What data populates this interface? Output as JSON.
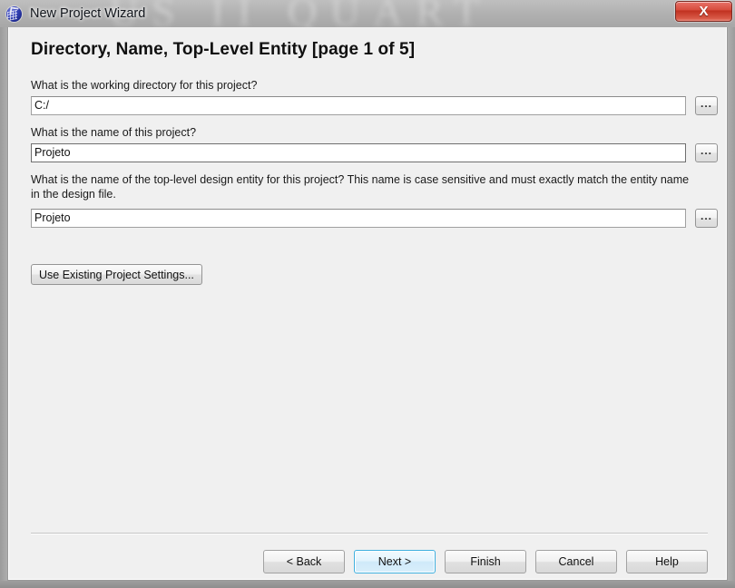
{
  "window": {
    "title": "New Project Wizard",
    "icon": "quartus-globe-icon",
    "close_label": "X",
    "backdrop_text": "US II  QUART",
    "colors": {
      "close_button": "#d64b3c",
      "default_button_border": "#3fb0df",
      "content_background": "#f0f0f0"
    }
  },
  "page": {
    "heading": "Directory, Name, Top-Level Entity [page 1 of 5]"
  },
  "fields": [
    {
      "label": "What is the working directory for this project?",
      "value": "C:/",
      "browse_label": "...",
      "focused": false
    },
    {
      "label": "What is the name of this project?",
      "value": "Projeto",
      "browse_label": "...",
      "focused": true
    },
    {
      "label": "What is the name of the top-level design entity for this project? This name is case sensitive and must exactly match the entity name in the design file.",
      "value": "Projeto",
      "browse_label": "...",
      "focused": false
    }
  ],
  "actions": {
    "use_existing_label": "Use Existing Project Settings..."
  },
  "footer": {
    "buttons": [
      {
        "label": "< Back",
        "default": false
      },
      {
        "label": "Next >",
        "default": true
      },
      {
        "label": "Finish",
        "default": false
      },
      {
        "label": "Cancel",
        "default": false
      },
      {
        "label": "Help",
        "default": false
      }
    ]
  }
}
